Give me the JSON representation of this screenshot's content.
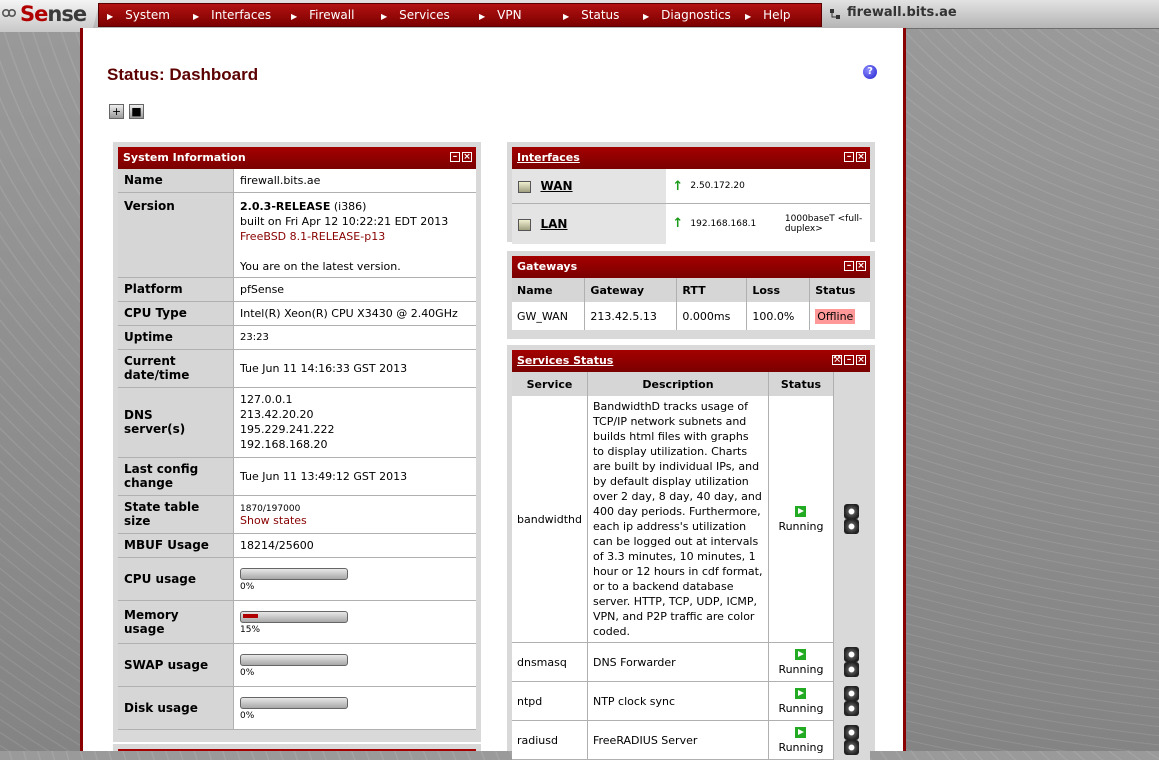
{
  "app": {
    "logo_text_a": "pf",
    "logo_text_b": "Se",
    "logo_text_c": "nse",
    "hostname": "firewall.bits.ae"
  },
  "nav": [
    {
      "label": "System"
    },
    {
      "label": "Interfaces"
    },
    {
      "label": "Firewall"
    },
    {
      "label": "Services"
    },
    {
      "label": "VPN"
    },
    {
      "label": "Status"
    },
    {
      "label": "Diagnostics"
    },
    {
      "label": "Help"
    }
  ],
  "page": {
    "title": "Status: Dashboard"
  },
  "sysinfo": {
    "title": "System Information",
    "name_label": "Name",
    "name": "firewall.bits.ae",
    "version_label": "Version",
    "version": "2.0.3-RELEASE",
    "arch": " (i386)",
    "built": "built on Fri Apr 12 10:22:21 EDT 2013",
    "freebsd": "FreeBSD 8.1-RELEASE-p13",
    "latest": "You are on the latest version.",
    "platform_label": "Platform",
    "platform": "pfSense",
    "cpu_label": "CPU Type",
    "cpu": "Intel(R) Xeon(R) CPU X3430 @ 2.40GHz",
    "uptime_label": "Uptime",
    "uptime": "23:23",
    "date_label_1": "Current",
    "date_label_2": "date/time",
    "date": "Tue Jun 11 14:16:33 GST 2013",
    "dns_label_1": "DNS",
    "dns_label_2": "server(s)",
    "dns": [
      "127.0.0.1",
      "213.42.20.20",
      "195.229.241.222",
      "192.168.168.20"
    ],
    "lastcfg_label_1": "Last config",
    "lastcfg_label_2": "change",
    "lastcfg": "Tue Jun 11 13:49:12 GST 2013",
    "state_label_1": "State table",
    "state_label_2": "size",
    "state": "1870/197000",
    "show_states": "Show states",
    "mbuf_label": "MBUF Usage",
    "mbuf": "18214/25600",
    "cpu_usage_label": "CPU usage",
    "cpu_usage_pct": "0%",
    "cpu_usage": 0,
    "mem_label_1": "Memory",
    "mem_label_2": "usage",
    "mem_pct": "15%",
    "mem": 0.15,
    "swap_label": "SWAP usage",
    "swap_pct": "0%",
    "swap": 0,
    "disk_label": "Disk usage",
    "disk_pct": "0%",
    "disk": 0
  },
  "interfaces": {
    "title": "Interfaces",
    "rows": [
      {
        "name": "WAN",
        "ip": "2.50.172.20",
        "media": ""
      },
      {
        "name": "LAN",
        "ip": "192.168.168.1",
        "media": "1000baseT <full-duplex>"
      }
    ]
  },
  "gateways": {
    "title": "Gateways",
    "headers": [
      "Name",
      "Gateway",
      "RTT",
      "Loss",
      "Status"
    ],
    "rows": [
      {
        "name": "GW_WAN",
        "gateway": "213.42.5.13",
        "rtt": "0.000ms",
        "loss": "100.0%",
        "status": "Offline"
      }
    ]
  },
  "services": {
    "title": "Services Status",
    "headers": [
      "Service",
      "Description",
      "Status"
    ],
    "rows": [
      {
        "service": "bandwidthd",
        "description": "BandwidthD tracks usage of TCP/IP network subnets and builds html files with graphs to display utilization. Charts are built by individual IPs, and by default display utilization over 2 day, 8 day, 40 day, and 400 day periods. Furthermore, each ip address's utilization can be logged out at intervals of 3.3 minutes, 10 minutes, 1 hour or 12 hours in cdf format, or to a backend database server. HTTP, TCP, UDP, ICMP, VPN, and P2P traffic are color coded.",
        "status": "Running"
      },
      {
        "service": "dnsmasq",
        "description": "DNS Forwarder",
        "status": "Running"
      },
      {
        "service": "ntpd",
        "description": "NTP clock sync",
        "status": "Running"
      },
      {
        "service": "radiusd",
        "description": "FreeRADIUS Server",
        "status": "Running"
      }
    ]
  },
  "colors": {
    "accent": "#a40000",
    "nav": "#7c0000",
    "offline": "#ff9999",
    "running": "#22aa22"
  }
}
